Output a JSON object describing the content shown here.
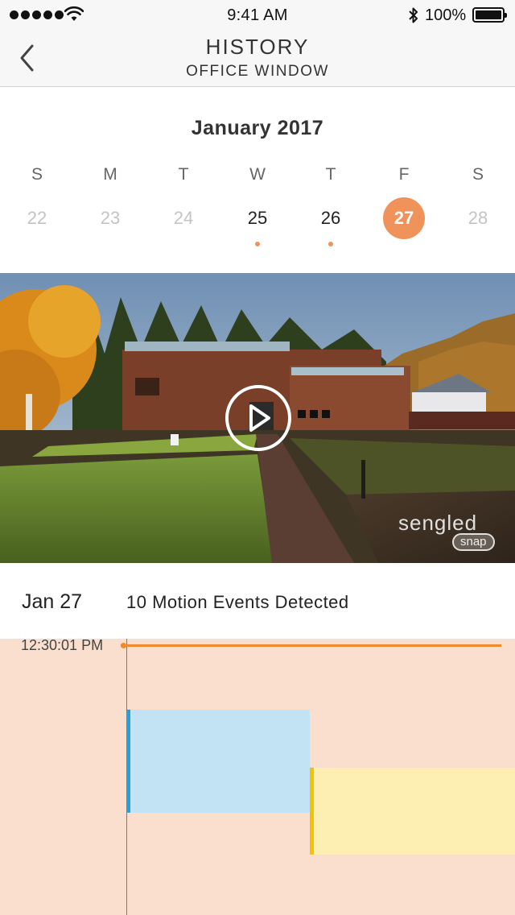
{
  "status_bar": {
    "time": "9:41 AM",
    "battery": "100%",
    "icons": [
      "signal-dots-icon",
      "wifi-icon",
      "bluetooth-icon",
      "battery-icon"
    ]
  },
  "nav": {
    "back_icon": "chevron-left-icon",
    "title": "HISTORY",
    "subtitle": "OFFICE WINDOW"
  },
  "calendar": {
    "month": "January 2017",
    "weekdays": [
      "S",
      "M",
      "T",
      "W",
      "T",
      "F",
      "S"
    ],
    "days": [
      {
        "label": "22",
        "state": "muted",
        "has_events": false
      },
      {
        "label": "23",
        "state": "muted",
        "has_events": false
      },
      {
        "label": "24",
        "state": "muted",
        "has_events": false
      },
      {
        "label": "25",
        "state": "active",
        "has_events": true
      },
      {
        "label": "26",
        "state": "active",
        "has_events": true
      },
      {
        "label": "27",
        "state": "selected",
        "has_events": false
      },
      {
        "label": "28",
        "state": "muted",
        "has_events": false
      }
    ]
  },
  "video": {
    "play_icon": "play-circle-icon",
    "brand": "sengled",
    "brand_sub": "snap"
  },
  "events": {
    "date": "Jan 27",
    "summary": "10 Motion Events Detected"
  },
  "timeline": {
    "current_time": "12:30:01 PM",
    "colors": {
      "accent": "#f0935a",
      "now_line": "#f08a2c",
      "background": "#fadfcf",
      "event_blue": "#2a9fdc",
      "event_yellow": "#f5c200"
    }
  }
}
